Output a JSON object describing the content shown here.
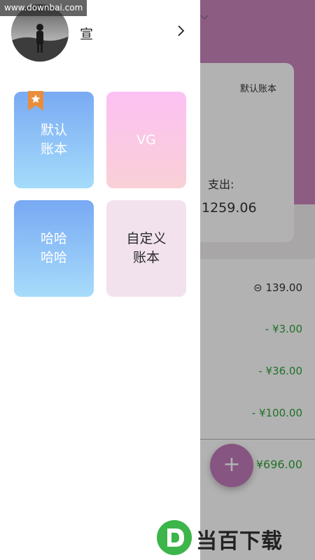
{
  "watermark": "www.downbai.com",
  "background": {
    "book_label": "默认账本",
    "expense_label": "支出:",
    "expense_amount": "1259.06",
    "rows": [
      {
        "text": "⊝ 139.00",
        "kind": "neutral"
      },
      {
        "text": "- ¥3.00",
        "kind": "expense"
      },
      {
        "text": "- ¥36.00",
        "kind": "expense"
      },
      {
        "text": "- ¥100.00",
        "kind": "expense"
      }
    ],
    "total": "¥696.00",
    "fab_label": "+",
    "dropdown_icon": "chevron-down-icon"
  },
  "drawer": {
    "user_name": "宣",
    "books": [
      {
        "line1": "默认",
        "line2": "账本",
        "default": true
      },
      {
        "line1": "VG",
        "line2": ""
      },
      {
        "line1": "哈哈",
        "line2": "哈哈"
      },
      {
        "line1": "自定义",
        "line2": "账本"
      }
    ]
  },
  "logo_text": "当百下载",
  "colors": {
    "header_pink": "#c985bb",
    "blue_card": "#79aaf3",
    "pink_card": "#fcc1f3",
    "custom_card": "#f2e2ee",
    "expense_green": "#2fa33a",
    "badge_orange": "#e98d3c"
  }
}
